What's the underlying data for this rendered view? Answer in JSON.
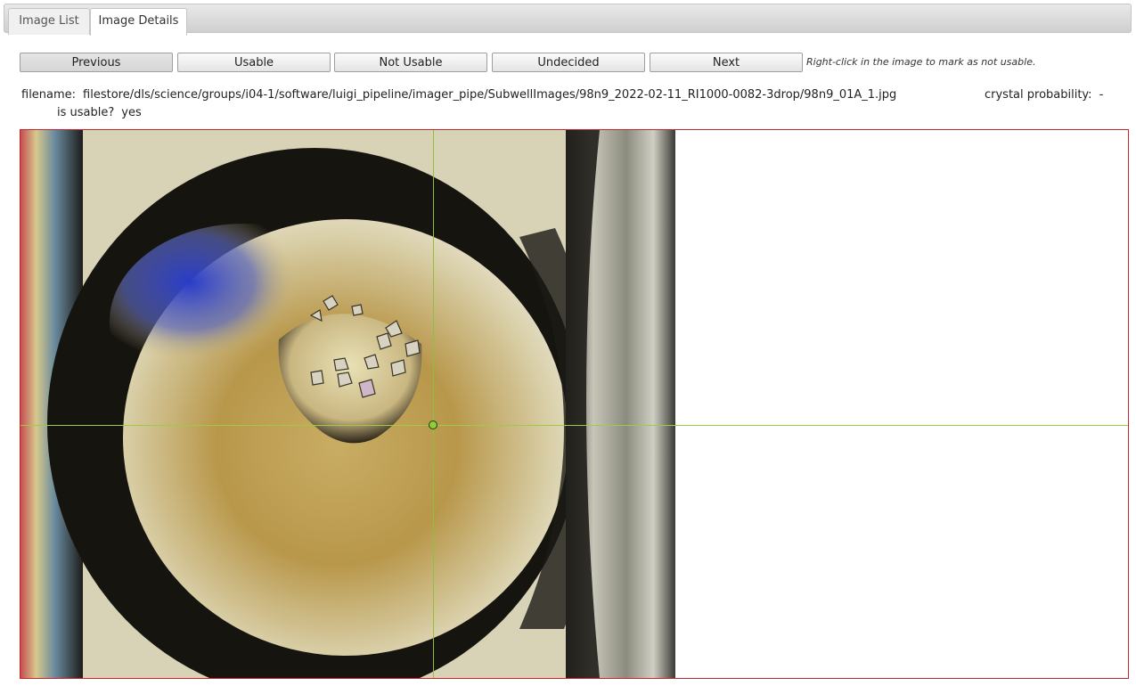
{
  "tabs": [
    {
      "label": "Image List",
      "active": false
    },
    {
      "label": "Image Details",
      "active": true
    }
  ],
  "toolbar": {
    "previous_label": "Previous",
    "usable_label": "Usable",
    "not_usable_label": "Not Usable",
    "undecided_label": "Undecided",
    "next_label": "Next",
    "hint": "Right-click in the image to mark as not usable."
  },
  "details": {
    "filename_label": "filename:",
    "filename_value": "filestore/dls/science/groups/i04-1/software/luigi_pipeline/imager_pipe/SubwellImages/98n9_2022-02-11_RI1000-0082-3drop/98n9_01A_1.jpg",
    "crystal_label": "crystal probability:",
    "crystal_value": "-",
    "usable_label": "is usable?",
    "usable_value": "yes"
  },
  "colors": {
    "panel_border": "#c8242c",
    "crosshair": "#9acd40"
  }
}
